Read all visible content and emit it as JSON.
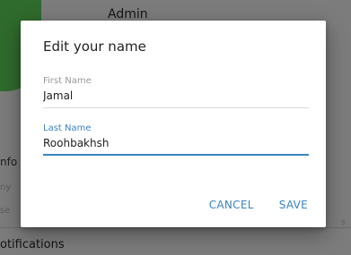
{
  "background": {
    "title": "Admin",
    "info_label": "nfo",
    "line1": "ny",
    "line2": "se",
    "notifications_label": "otifications",
    "right_text": "s"
  },
  "dialog": {
    "title": "Edit your name",
    "first_name": {
      "label": "First Name",
      "value": "Jamal"
    },
    "last_name": {
      "label": "Last Name",
      "value": "Roohbakhsh"
    },
    "cancel_label": "CANCEL",
    "save_label": "SAVE"
  },
  "colors": {
    "accent": "#3a84c4",
    "overlay": "#7c7c7c"
  }
}
